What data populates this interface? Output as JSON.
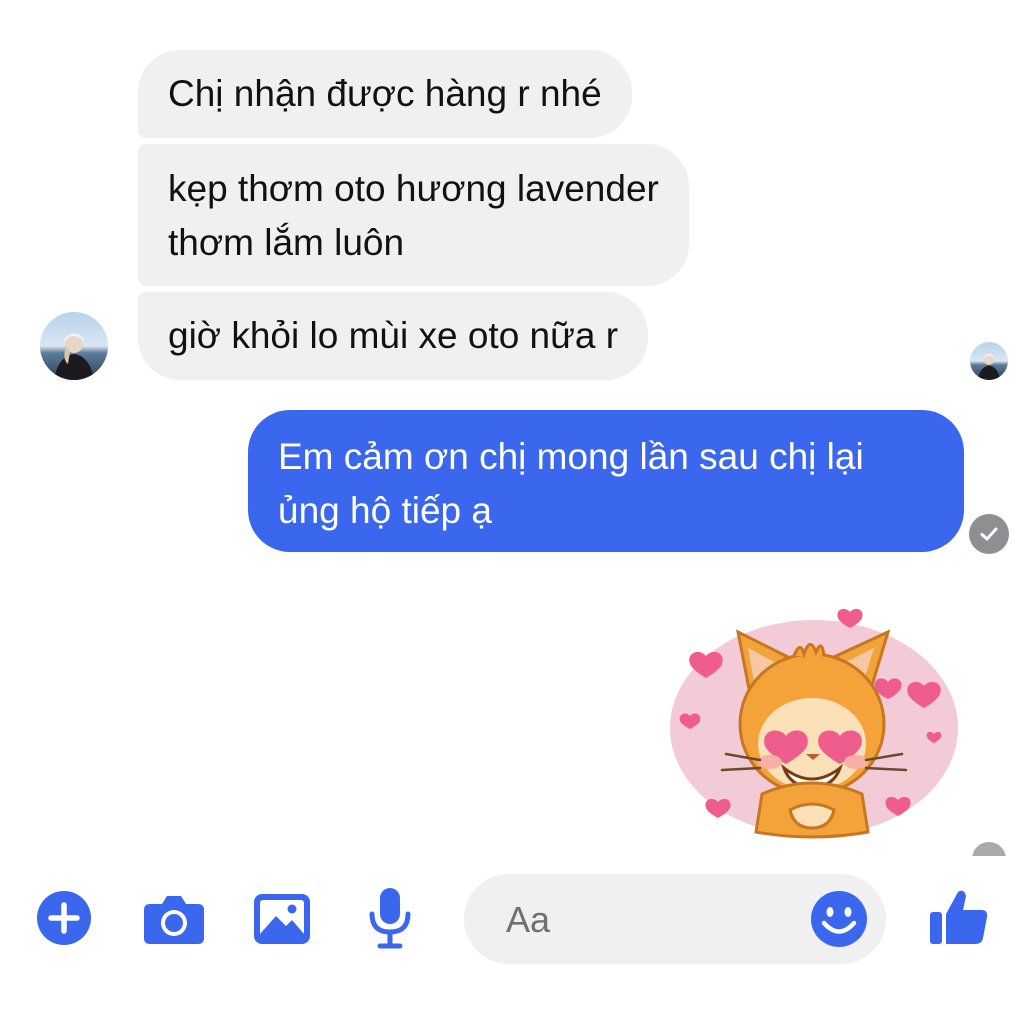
{
  "colors": {
    "accent": "#3b67ef",
    "incoming_bubble": "#f0f0f0",
    "incoming_text": "#111111",
    "outgoing_text": "#ffffff",
    "status_gray": "#8e8e93"
  },
  "messages": [
    {
      "direction": "incoming",
      "text": "Chị nhận được hàng r nhé"
    },
    {
      "direction": "incoming",
      "text": "kẹp thơm oto hương lavender\nthơm lắm luôn"
    },
    {
      "direction": "incoming",
      "text": "giờ khỏi lo mùi xe oto nữa r"
    },
    {
      "direction": "outgoing",
      "text": "Em cảm ơn chị mong lần sau chị lại\nủng hộ tiếp ạ"
    }
  ],
  "sticker": {
    "icon": "heart-eyes-cat-sticker"
  },
  "composer": {
    "placeholder": "Aa",
    "icons": [
      "plus-icon",
      "camera-icon",
      "image-icon",
      "microphone-icon",
      "emoji-icon",
      "thumbs-up-icon"
    ]
  }
}
